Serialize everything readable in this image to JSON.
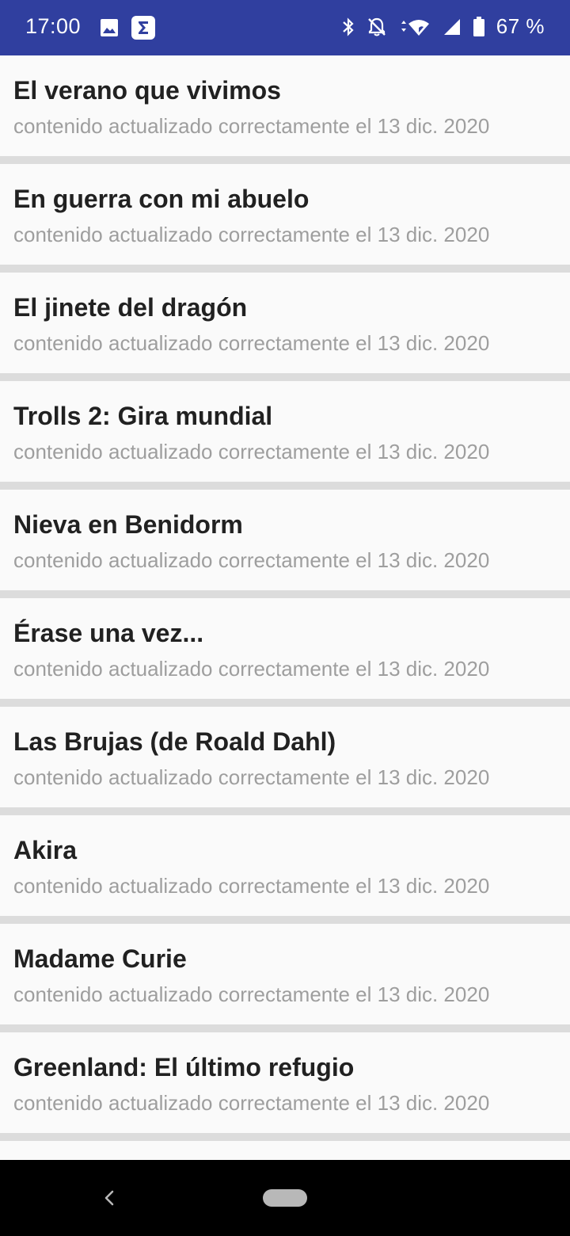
{
  "status_bar": {
    "time": "17:00",
    "battery": "67 %",
    "background": "#303f9f",
    "icons_left": [
      "image-icon",
      "sigma-app-icon"
    ],
    "icons_right": [
      "bluetooth-icon",
      "notifications-off-icon",
      "wifi-icon",
      "signal-icon",
      "battery-icon"
    ]
  },
  "list": {
    "items": [
      {
        "title": "El verano que vivimos",
        "subtitle": "contenido actualizado correctamente el 13 dic. 2020"
      },
      {
        "title": "En guerra con mi abuelo",
        "subtitle": "contenido actualizado correctamente el 13 dic. 2020"
      },
      {
        "title": "El jinete del dragón",
        "subtitle": "contenido actualizado correctamente el 13 dic. 2020"
      },
      {
        "title": "Trolls 2: Gira mundial",
        "subtitle": "contenido actualizado correctamente el 13 dic. 2020"
      },
      {
        "title": "Nieva en Benidorm",
        "subtitle": "contenido actualizado correctamente el 13 dic. 2020"
      },
      {
        "title": "Érase una vez...",
        "subtitle": "contenido actualizado correctamente el 13 dic. 2020"
      },
      {
        "title": "Las Brujas (de Roald Dahl)",
        "subtitle": "contenido actualizado correctamente el 13 dic. 2020"
      },
      {
        "title": "Akira",
        "subtitle": "contenido actualizado correctamente el 13 dic. 2020"
      },
      {
        "title": "Madame Curie",
        "subtitle": "contenido actualizado correctamente el 13 dic. 2020"
      },
      {
        "title": "Greenland: El último refugio",
        "subtitle": "contenido actualizado correctamente el 13 dic. 2020"
      }
    ]
  },
  "nav_bar": {
    "icons": [
      "back-icon",
      "home-pill-icon"
    ]
  }
}
